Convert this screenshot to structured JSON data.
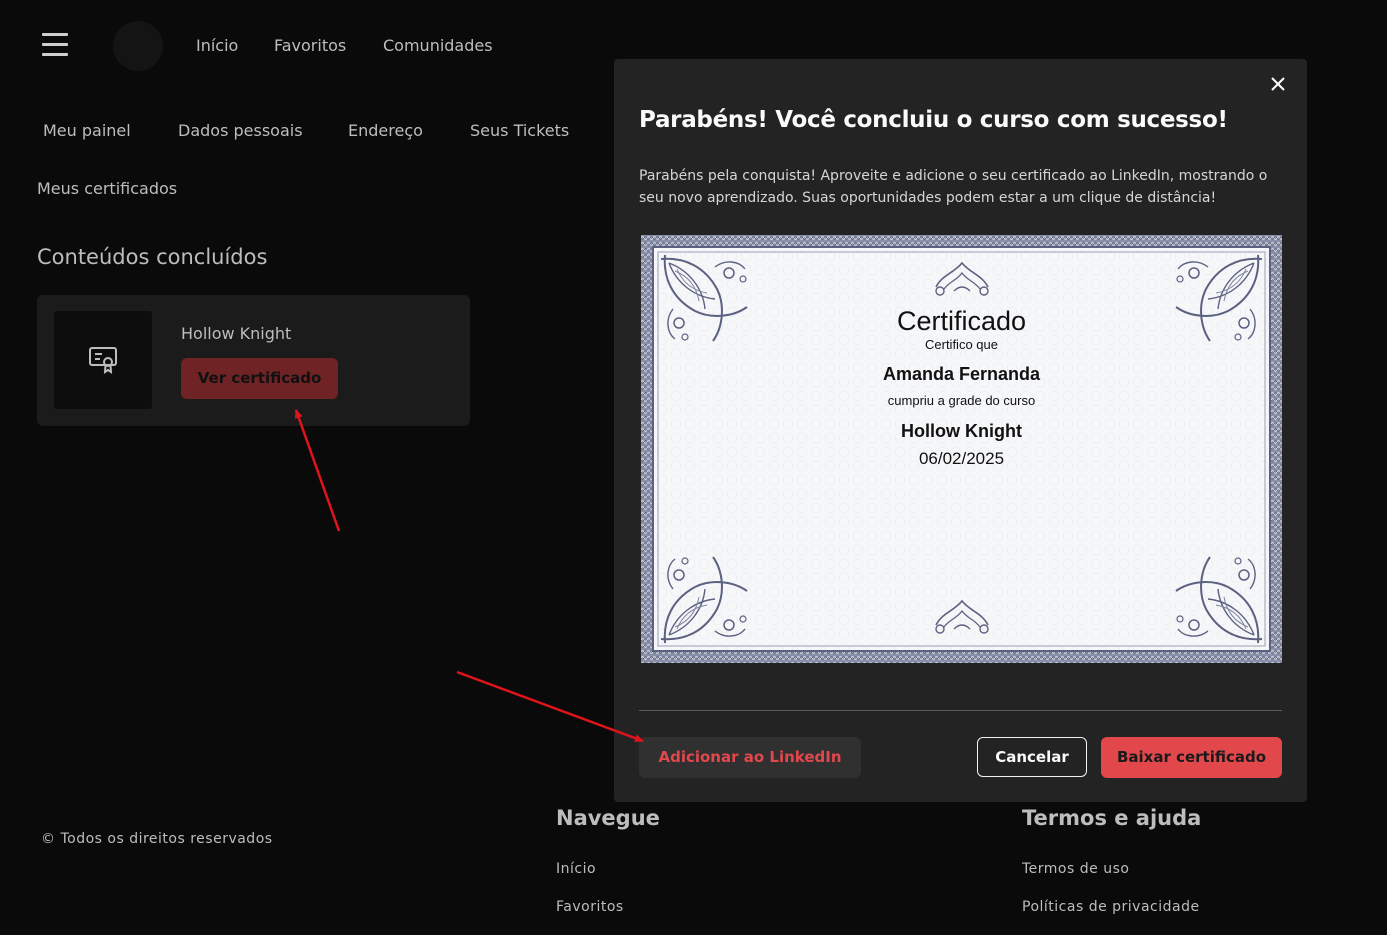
{
  "header": {
    "nav": [
      "Início",
      "Favoritos",
      "Comunidades"
    ]
  },
  "profile_tabs": [
    "Meu painel",
    "Dados pessoais",
    "Endereço",
    "Seus Tickets"
  ],
  "my_certificates_label": "Meus certificados",
  "completed": {
    "title": "Conteúdos concluídos",
    "card": {
      "course": "Hollow Knight",
      "button": "Ver certificado",
      "icon": "certificate-icon"
    }
  },
  "footer": {
    "copyright": "© Todos os direitos reservados",
    "navegue": {
      "title": "Navegue",
      "links": [
        "Início",
        "Favoritos"
      ]
    },
    "termos": {
      "title": "Termos e ajuda",
      "links": [
        "Termos de uso",
        "Políticas de privacidade"
      ]
    }
  },
  "modal": {
    "title": "Parabéns! Você concluiu o curso com sucesso!",
    "description": "Parabéns pela conquista! Aproveite e adicione o seu certificado ao LinkedIn, mostrando o seu novo aprendizado. Suas oportunidades podem estar a um clique de distância!",
    "certificate": {
      "heading": "Certificado",
      "certify": "Certifico que",
      "name": "Amanda Fernanda",
      "completed_text": "cumpriu a grade do curso",
      "course": "Hollow Knight",
      "date": "06/02/2025"
    },
    "buttons": {
      "linkedin": "Adicionar ao LinkedIn",
      "cancel": "Cancelar",
      "download": "Baixar certificado"
    }
  },
  "colors": {
    "background": "#0a0a0a",
    "modal": "#232323",
    "accent_red": "#e2474b",
    "dark_red_button": "#6f2325",
    "annotation_arrow": "#e0141b"
  }
}
